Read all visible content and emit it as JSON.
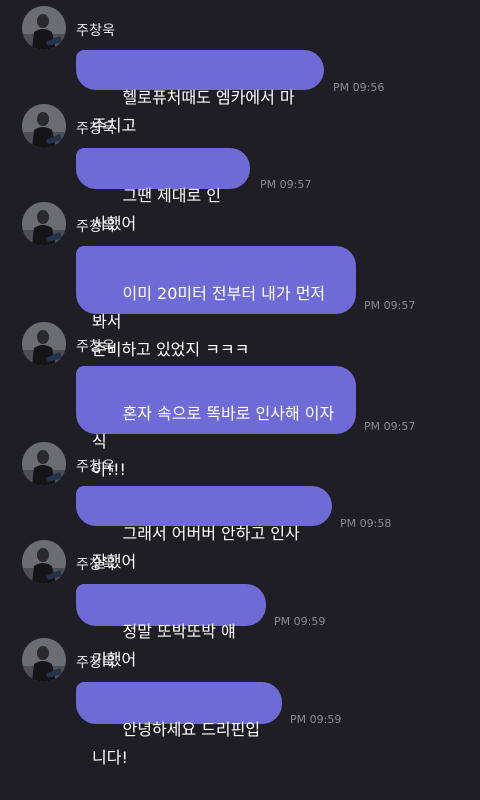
{
  "colors": {
    "background": "#1e1e24",
    "bubble": "#6e6ad6",
    "bubble_text": "#ffffff",
    "sender_text": "#e8e8ee",
    "timestamp_text": "#8a8a92"
  },
  "messages": [
    {
      "sender": "주창욱",
      "text": "헬로퓨처때도 엠카에서 마주치고",
      "time": "PM 09:56"
    },
    {
      "sender": "주창욱",
      "text": "그땐 제대로 인사했어",
      "time": "PM 09:57"
    },
    {
      "sender": "주창욱",
      "text": "이미 20미터 전부터 내가 먼저 봐서\n준비하고 있었지 ㅋㅋㅋ",
      "time": "PM 09:57"
    },
    {
      "sender": "주창욱",
      "text": "혼자 속으로 똑바로 인사해 이자식\n아!!!",
      "time": "PM 09:57"
    },
    {
      "sender": "주창욱",
      "text": "그래서 어버버 안하고 인사 잘했어",
      "time": "PM 09:58"
    },
    {
      "sender": "주창욱",
      "text": "정말 또박또박 얘기했어",
      "time": "PM 09:59"
    },
    {
      "sender": "주창욱",
      "text": "안녕하세요 드리핀입니다!",
      "time": "PM 09:59"
    }
  ]
}
